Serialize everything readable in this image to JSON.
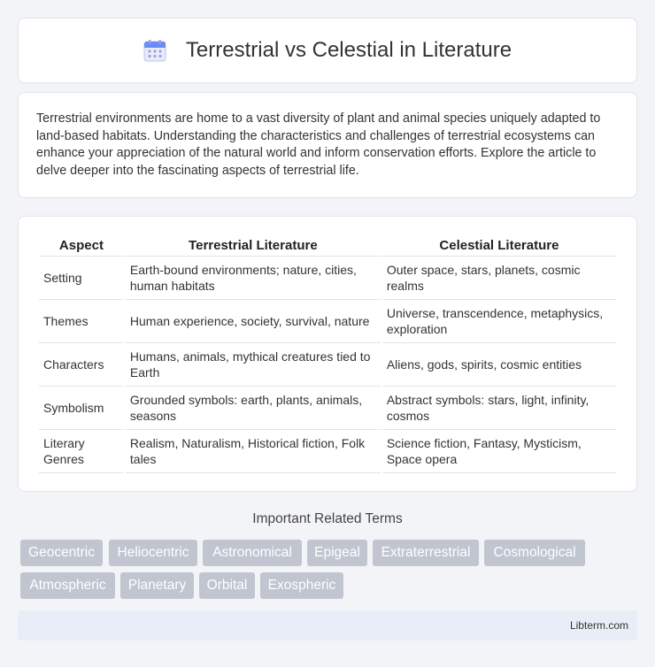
{
  "header": {
    "title": "Terrestrial vs Celestial in Literature",
    "icon": "calendar-icon"
  },
  "intro": {
    "text": "Terrestrial environments are home to a vast diversity of plant and animal species uniquely adapted to land-based habitats. Understanding the characteristics and challenges of terrestrial ecosystems can enhance your appreciation of the natural world and inform conservation efforts. Explore the article to delve deeper into the fascinating aspects of terrestrial life."
  },
  "table": {
    "headers": [
      "Aspect",
      "Terrestrial Literature",
      "Celestial Literature"
    ],
    "rows": [
      [
        "Setting",
        "Earth-bound environments; nature, cities, human habitats",
        "Outer space, stars, planets, cosmic realms"
      ],
      [
        "Themes",
        "Human experience, society, survival, nature",
        "Universe, transcendence, metaphysics, exploration"
      ],
      [
        "Characters",
        "Humans, animals, mythical creatures tied to Earth",
        "Aliens, gods, spirits, cosmic entities"
      ],
      [
        "Symbolism",
        "Grounded symbols: earth, plants, animals, seasons",
        "Abstract symbols: stars, light, infinity, cosmos"
      ],
      [
        "Literary Genres",
        "Realism, Naturalism, Historical fiction, Folk tales",
        "Science fiction, Fantasy, Mysticism, Space opera"
      ]
    ]
  },
  "related": {
    "title": "Important Related Terms",
    "tags": [
      "Geocentric",
      "Heliocentric",
      "Astronomical",
      "Epigeal",
      "Extraterrestrial",
      "Cosmological",
      "Atmospheric",
      "Planetary",
      "Orbital",
      "Exospheric"
    ]
  },
  "footer": {
    "text": "Libterm.com"
  },
  "colors": {
    "tag_bg": "#c0c5d0",
    "footer_bg": "#e9edf7",
    "page_bg": "#f3f4f8"
  }
}
